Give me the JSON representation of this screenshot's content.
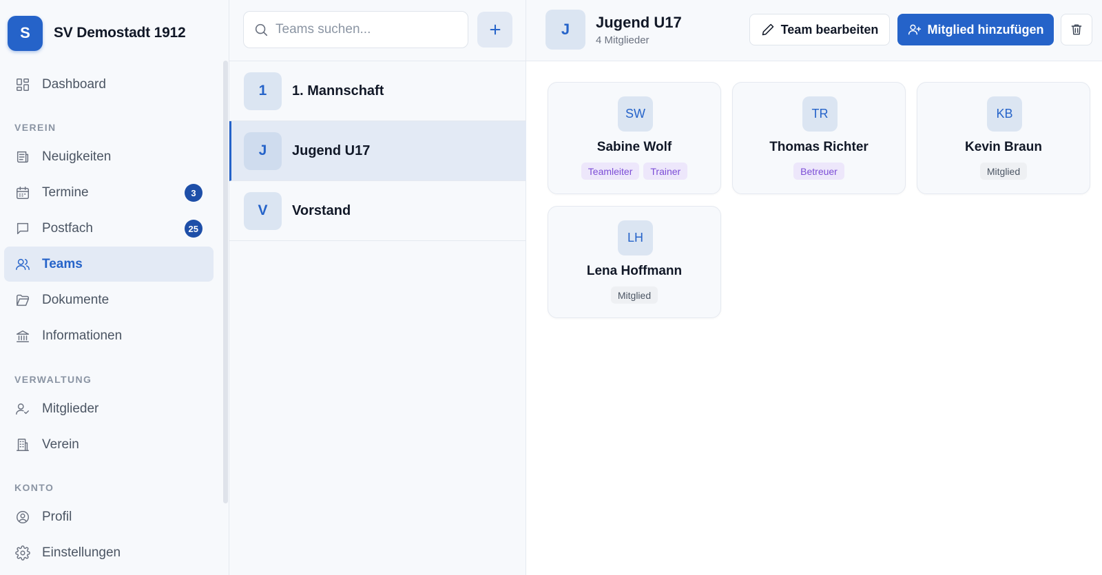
{
  "app": {
    "logo_letter": "S",
    "club_name": "SV Demostadt 1912"
  },
  "sidebar": {
    "dashboard": {
      "label": "Dashboard",
      "icon": "dashboard-icon"
    },
    "sections": {
      "verein": "VEREIN",
      "verwaltung": "VERWALTUNG",
      "konto": "KONTO"
    },
    "items": {
      "neuigkeiten": {
        "label": "Neuigkeiten",
        "icon": "newspaper-icon"
      },
      "termine": {
        "label": "Termine",
        "icon": "calendar-icon",
        "badge": "3"
      },
      "postfach": {
        "label": "Postfach",
        "icon": "message-icon",
        "badge": "25"
      },
      "teams": {
        "label": "Teams",
        "icon": "users-icon",
        "active": true
      },
      "dokumente": {
        "label": "Dokumente",
        "icon": "folder-icon"
      },
      "informationen": {
        "label": "Informationen",
        "icon": "landmark-icon"
      },
      "mitglieder": {
        "label": "Mitglieder",
        "icon": "user-check-icon"
      },
      "verein": {
        "label": "Verein",
        "icon": "building-icon"
      },
      "profil": {
        "label": "Profil",
        "icon": "user-circle-icon"
      },
      "einstellungen": {
        "label": "Einstellungen",
        "icon": "gear-icon"
      }
    }
  },
  "teamlist": {
    "search_placeholder": "Teams suchen...",
    "teams": [
      {
        "initial": "1",
        "name": "1. Mannschaft"
      },
      {
        "initial": "J",
        "name": "Jugend U17",
        "selected": true
      },
      {
        "initial": "V",
        "name": "Vorstand"
      }
    ]
  },
  "main": {
    "team_initial": "J",
    "team_name": "Jugend U17",
    "member_count": "4 Mitglieder",
    "edit_label": "Team bearbeiten",
    "add_member_label": "Mitglied hinzufügen",
    "members": [
      {
        "initials": "SW",
        "name": "Sabine Wolf",
        "roles": [
          "Teamleiter",
          "Trainer"
        ]
      },
      {
        "initials": "TR",
        "name": "Thomas Richter",
        "roles": [
          "Betreuer"
        ]
      },
      {
        "initials": "KB",
        "name": "Kevin Braun",
        "roles": [
          "Mitglied"
        ]
      },
      {
        "initials": "LH",
        "name": "Lena Hoffmann",
        "roles": [
          "Mitglied"
        ]
      }
    ]
  },
  "colors": {
    "accent": "#2563c9",
    "badge": "#1e4fa8",
    "role_purple": "#7c4dd6",
    "active_bg": "#e3eaf5"
  }
}
